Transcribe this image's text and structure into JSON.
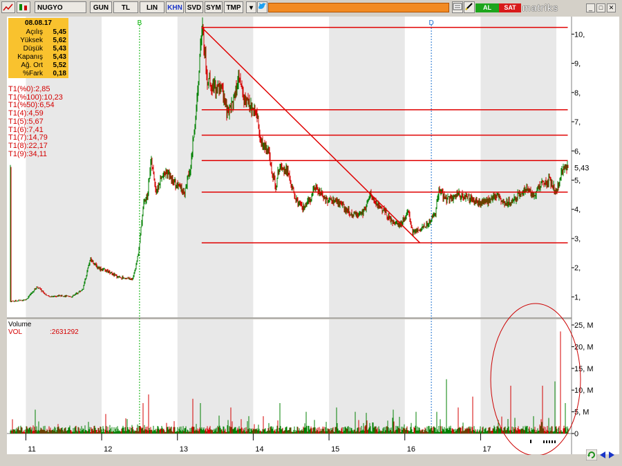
{
  "toolbar": {
    "symbol": "NUGYO",
    "buttons": [
      "GUN",
      "TL",
      "LIN",
      "KHN",
      "SVD",
      "SYM",
      "TMP"
    ],
    "active_button": "KHN",
    "buy_label": "AL",
    "sell_label": "SAT",
    "brand": "matriks",
    "icons": [
      "chart-icon",
      "dropdown-icon",
      "twitter-icon",
      "minimize-icon",
      "maximize-icon",
      "close-icon",
      "refresh-icon",
      "scroll-left-icon",
      "scroll-right-icon"
    ]
  },
  "info_box": {
    "date": "08.08.17",
    "rows": [
      {
        "label": "Açılış",
        "value": "5,45"
      },
      {
        "label": "Yüksek",
        "value": "5,62"
      },
      {
        "label": "Düşük",
        "value": "5,43"
      },
      {
        "label": "Kapanış",
        "value": "5,43"
      },
      {
        "label": "Ağ. Ort",
        "value": "5,52"
      },
      {
        "label": "%Fark",
        "value": "0,18"
      }
    ]
  },
  "levels": [
    "T1(%0):2,85",
    "T1(%100):10,23",
    "T1(%50):6,54",
    "T1(4):4,59",
    "T1(5):5,67",
    "T1(6):7,41",
    "T1(7):14,79",
    "T1(8):22,17",
    "T1(9):34,11"
  ],
  "volume_panel": {
    "title": "Volume",
    "series_label": "VOL",
    "series_value": ":2631292"
  },
  "colors": {
    "up": "#008000",
    "down": "#d40000",
    "lines": "#e00000",
    "shade": "#e8e8e8",
    "marker_green": "#00b000",
    "marker_blue": "#1a6fd0",
    "info_bg": "#f9c22e"
  },
  "chart_data": {
    "type": "candlestick",
    "x_ticks": [
      "11",
      "12",
      "13",
      "14",
      "15",
      "16",
      "17"
    ],
    "y_ticks": [
      "1,",
      "2,",
      "3,",
      "4,",
      "5,",
      "6,",
      "7,",
      "8,",
      "9,",
      "10,"
    ],
    "ylim": [
      0.3,
      10.6
    ],
    "last_price_label": "5,43",
    "last_price": 5.43,
    "year_positions": [
      11.5,
      12.5,
      13.5,
      14.5,
      15.5,
      16.5,
      17.5
    ],
    "price_path": [
      [
        10.8,
        0.85
      ],
      [
        11.0,
        0.9
      ],
      [
        11.15,
        1.35
      ],
      [
        11.3,
        1.0
      ],
      [
        11.45,
        1.05
      ],
      [
        11.6,
        1.0
      ],
      [
        11.75,
        1.25
      ],
      [
        11.85,
        2.3
      ],
      [
        11.95,
        2.0
      ],
      [
        12.05,
        1.9
      ],
      [
        12.2,
        1.7
      ],
      [
        12.4,
        1.6
      ],
      [
        12.45,
        2.0
      ],
      [
        12.5,
        2.8
      ],
      [
        12.55,
        4.2
      ],
      [
        12.6,
        4.4
      ],
      [
        12.65,
        5.7
      ],
      [
        12.72,
        4.6
      ],
      [
        12.78,
        5.0
      ],
      [
        12.85,
        5.3
      ],
      [
        12.95,
        4.9
      ],
      [
        13.1,
        4.6
      ],
      [
        13.18,
        5.6
      ],
      [
        13.25,
        7.5
      ],
      [
        13.3,
        9.5
      ],
      [
        13.33,
        10.2
      ],
      [
        13.4,
        8.4
      ],
      [
        13.5,
        8.2
      ],
      [
        13.6,
        8.0
      ],
      [
        13.65,
        7.3
      ],
      [
        13.75,
        7.8
      ],
      [
        13.8,
        8.5
      ],
      [
        13.9,
        7.7
      ],
      [
        14.05,
        7.2
      ],
      [
        14.1,
        6.3
      ],
      [
        14.2,
        6.0
      ],
      [
        14.25,
        5.2
      ],
      [
        14.3,
        4.8
      ],
      [
        14.35,
        5.6
      ],
      [
        14.45,
        5.3
      ],
      [
        14.55,
        4.4
      ],
      [
        14.65,
        4.0
      ],
      [
        14.75,
        4.3
      ],
      [
        14.8,
        4.8
      ],
      [
        14.9,
        4.5
      ],
      [
        15.0,
        4.3
      ],
      [
        15.15,
        4.2
      ],
      [
        15.3,
        3.8
      ],
      [
        15.45,
        3.9
      ],
      [
        15.55,
        4.5
      ],
      [
        15.65,
        4.1
      ],
      [
        15.75,
        3.9
      ],
      [
        15.85,
        3.5
      ],
      [
        15.95,
        3.5
      ],
      [
        16.05,
        3.9
      ],
      [
        16.1,
        3.2
      ],
      [
        16.2,
        3.3
      ],
      [
        16.3,
        3.5
      ],
      [
        16.4,
        3.8
      ],
      [
        16.45,
        4.7
      ],
      [
        16.55,
        4.3
      ],
      [
        16.7,
        4.5
      ],
      [
        16.85,
        4.4
      ],
      [
        17.0,
        4.2
      ],
      [
        17.1,
        4.3
      ],
      [
        17.2,
        4.5
      ],
      [
        17.3,
        4.3
      ],
      [
        17.4,
        4.2
      ],
      [
        17.5,
        4.5
      ],
      [
        17.6,
        4.7
      ],
      [
        17.7,
        4.5
      ],
      [
        17.8,
        4.9
      ],
      [
        17.9,
        5.0
      ],
      [
        18.0,
        4.6
      ],
      [
        18.05,
        5.1
      ],
      [
        18.1,
        5.45
      ],
      [
        18.15,
        5.43
      ]
    ],
    "fib_levels": [
      2.85,
      4.59,
      5.67,
      6.54,
      7.41,
      10.23
    ],
    "trendline": {
      "from": [
        13.32,
        10.23
      ],
      "to": [
        16.2,
        2.85
      ]
    },
    "markers": [
      {
        "label": "B",
        "x": 12.5
      },
      {
        "label": "D",
        "x": 16.35
      }
    ],
    "volume_ticks": [
      "0",
      "5, M",
      "10, M",
      "15, M",
      "20, M",
      "25, M"
    ],
    "volume_ylim": [
      0,
      25
    ],
    "volume_spikes": [
      [
        11.12,
        5.5
      ],
      [
        12.05,
        4.5
      ],
      [
        12.55,
        7
      ],
      [
        12.62,
        9
      ],
      [
        13.2,
        8
      ],
      [
        13.3,
        7
      ],
      [
        13.7,
        6
      ],
      [
        14.35,
        7
      ],
      [
        14.7,
        5
      ],
      [
        15.1,
        6
      ],
      [
        15.35,
        5
      ],
      [
        15.85,
        5.5
      ],
      [
        16.15,
        5
      ],
      [
        16.42,
        5
      ],
      [
        16.55,
        12.5
      ],
      [
        16.7,
        6
      ],
      [
        16.9,
        8.5
      ],
      [
        17.4,
        11
      ],
      [
        17.7,
        4
      ],
      [
        17.82,
        11
      ],
      [
        17.98,
        12
      ],
      [
        18.05,
        23.5
      ],
      [
        18.12,
        7
      ]
    ]
  }
}
